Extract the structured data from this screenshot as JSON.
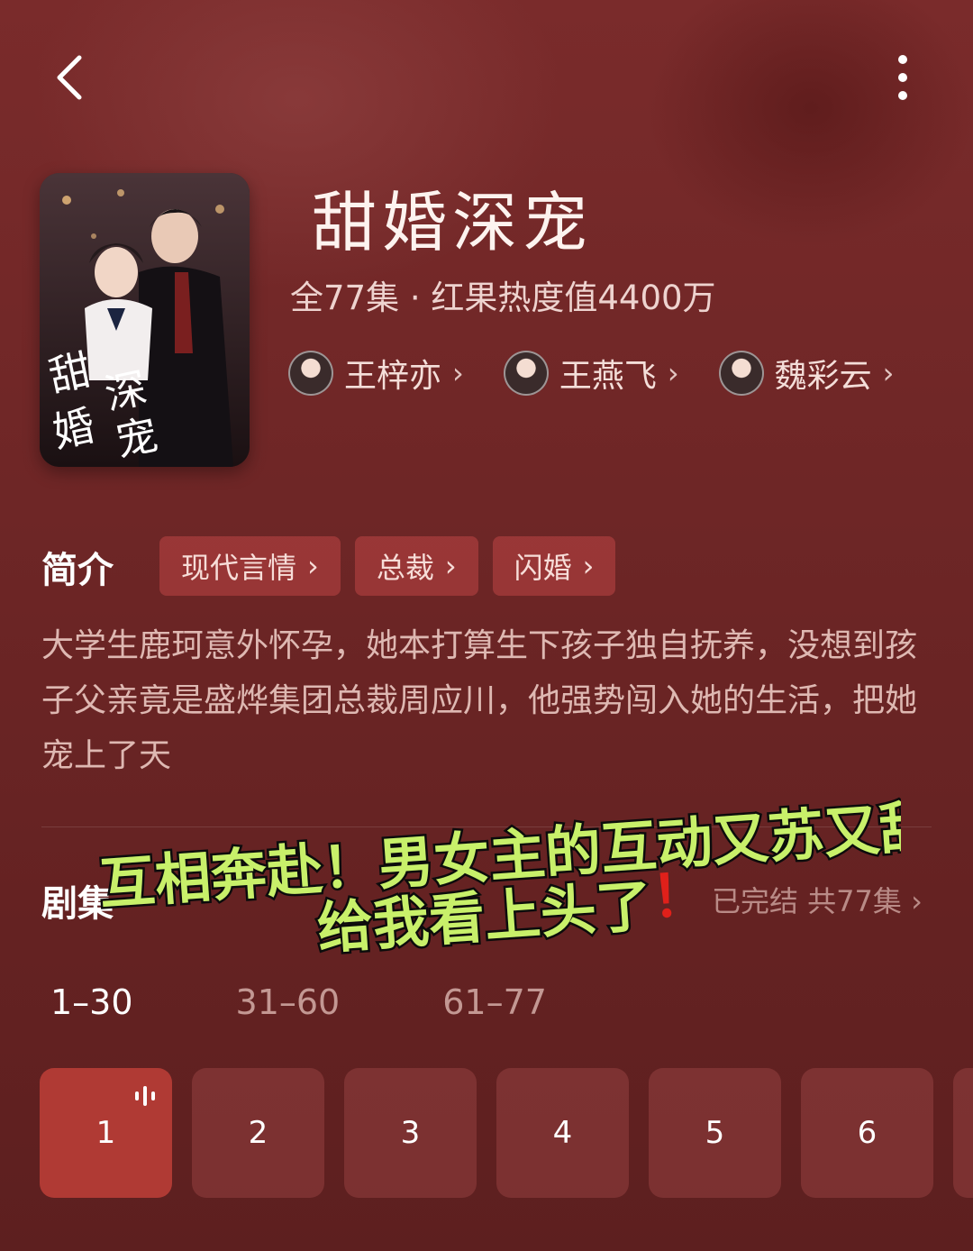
{
  "header": {
    "back_icon": "chevron-left-icon",
    "more_icon": "more-vertical-icon"
  },
  "show": {
    "poster_lines": [
      "甜",
      "深",
      "婚",
      "宠"
    ],
    "title": "甜婚深宠",
    "meta": "全77集 · 红果热度值4400万"
  },
  "cast": [
    {
      "name": "王梓亦"
    },
    {
      "name": "王燕飞"
    },
    {
      "name": "魏彩云"
    }
  ],
  "intro": {
    "label": "简介",
    "tags": [
      "现代言情",
      "总裁",
      "闪婚"
    ],
    "description": "大学生鹿珂意外怀孕，她本打算生下孩子独自抚养，没想到孩子父亲竟是盛烨集团总裁周应川，他强势闯入她的生活，把她宠上了天"
  },
  "episodes": {
    "label": "剧集",
    "status": "已完结 共77集",
    "ranges": [
      "1–30",
      "31–60",
      "61–77"
    ],
    "items": [
      "1",
      "2",
      "3",
      "4",
      "5",
      "6"
    ]
  },
  "overlay": {
    "line1": "互相奔赴！男女主的互动又苏又甜",
    "line2": "给我看上头了",
    "exclaim": "！"
  },
  "colors": {
    "accent": "#b03a34",
    "overlay_text": "#c8f06a"
  }
}
